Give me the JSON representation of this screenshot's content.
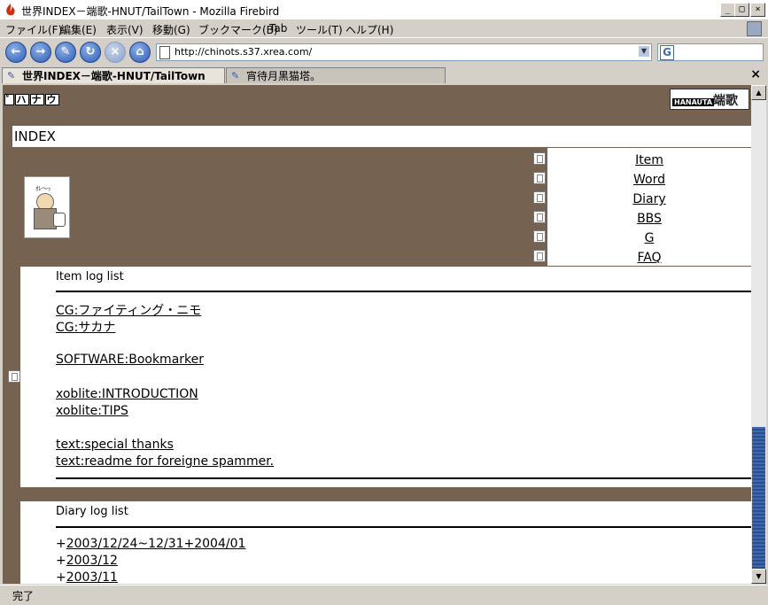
{
  "window": {
    "title": "世界INDEX－端歌-HNUT/TailTown - Mozilla Firebird",
    "controls": [
      "minimize",
      "maximize",
      "close"
    ]
  },
  "menu": [
    "ファイル(F)",
    "編集(E)",
    "表示(V)",
    "移動(G)",
    "ブックマーク(B)",
    "Tab",
    "ツール(T)",
    "ヘルプ(H)"
  ],
  "nav": {
    "url": "http://chinots.s37.xrea.com/",
    "search_icon": "G"
  },
  "tabs": [
    {
      "label": "世界INDEX－端歌-HNUT/TailTown",
      "active": true
    },
    {
      "label": "宵待月黒猫塔。",
      "active": false
    }
  ],
  "page": {
    "hana_icon": [
      "ﾟ",
      "ハ",
      "ナ",
      "ウ"
    ],
    "logo_small": "HANAUTA",
    "logo_big": "端歌",
    "index_title": "INDEX",
    "avatar_text": "ｵﾚ〜ｯ",
    "nav_links": [
      "Item",
      "Word",
      "Diary",
      "BBS",
      "G",
      "FAQ"
    ],
    "item_panel": {
      "title": "Item log list",
      "links": [
        "CG:ファイティング・ニモ",
        "CG:サカナ",
        "SOFTWARE:Bookmarker",
        "xoblite:INTRODUCTION",
        "xoblite:TIPS",
        "text:special thanks",
        "text:readme for foreigne spammer."
      ]
    },
    "diary_panel": {
      "title": "Diary log list",
      "entries": [
        {
          "prefix": "+",
          "link": "2003/12/24~12/31+2004/01"
        },
        {
          "prefix": "+",
          "link": "2003/12"
        },
        {
          "prefix": "+",
          "link": "2003/11"
        }
      ]
    }
  },
  "status": {
    "text": "完了"
  }
}
